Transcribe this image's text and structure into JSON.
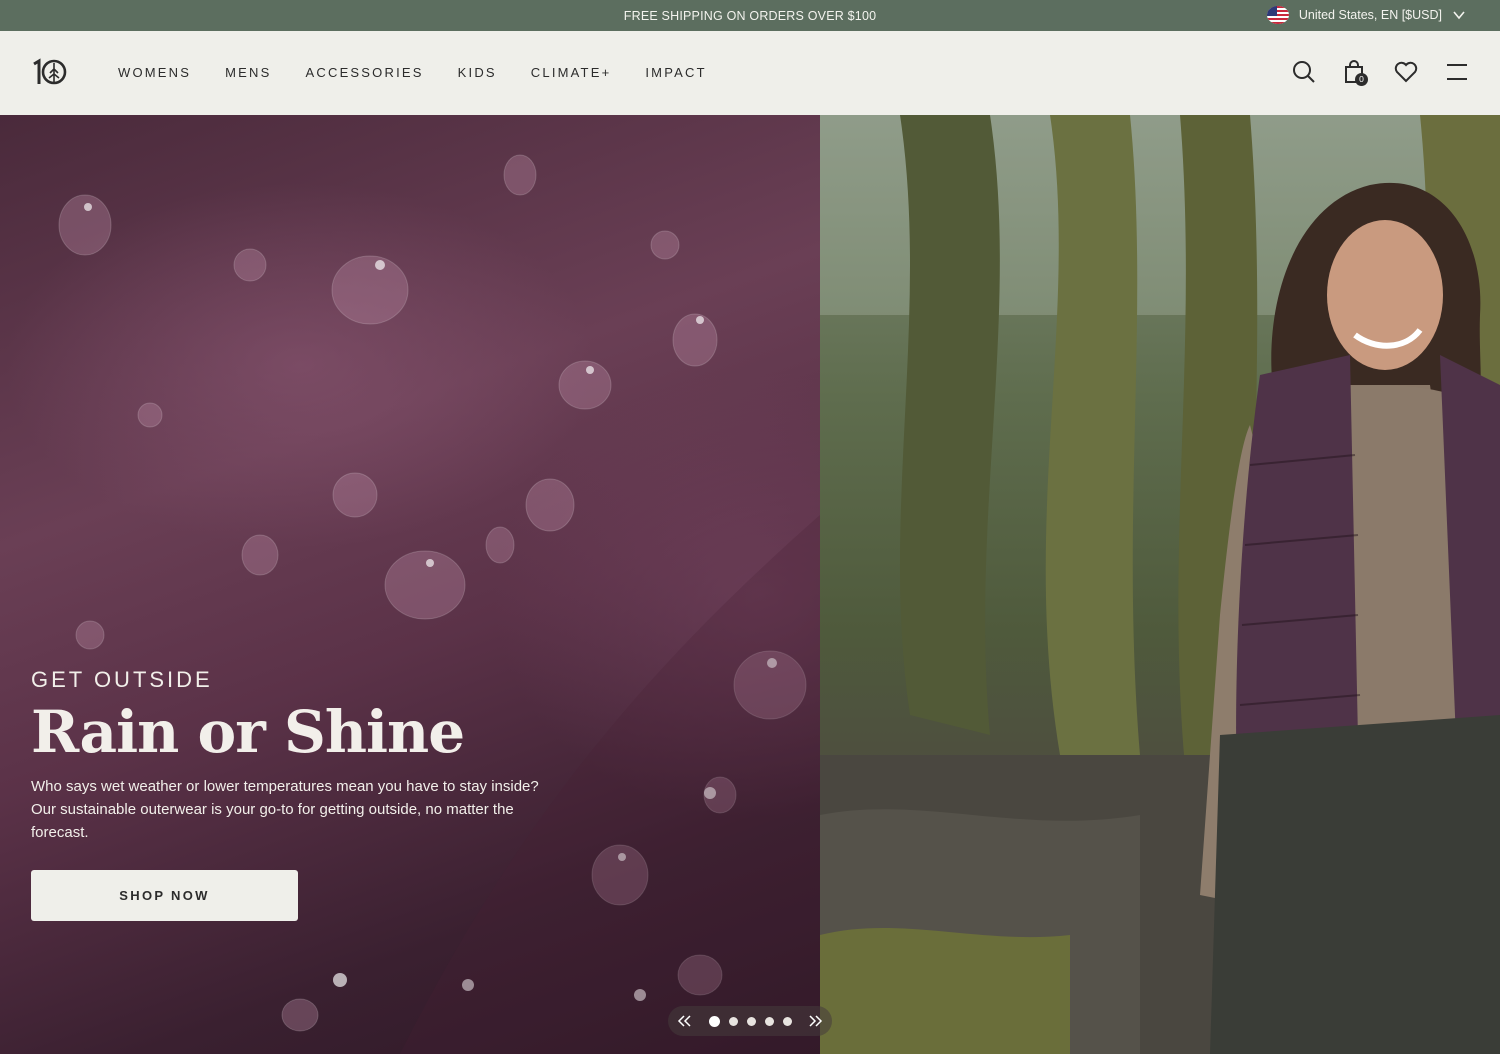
{
  "announcement": {
    "text": "FREE SHIPPING ON ORDERS OVER $100"
  },
  "locale": {
    "label": "United States, EN [$USD]",
    "flag_icon": "us-flag-icon"
  },
  "nav": {
    "logo_alt": "tentree logo",
    "items": [
      "WOMENS",
      "MENS",
      "ACCESSORIES",
      "KIDS",
      "CLIMATE+",
      "IMPACT"
    ],
    "cart_count": "0",
    "icons": [
      "search-icon",
      "bag-icon",
      "heart-icon",
      "hamburger-menu-icon"
    ]
  },
  "hero": {
    "eyebrow": "GET OUTSIDE",
    "headline": "Rain or Shine",
    "body": "Who says wet weather or lower temperatures mean you have to stay inside? Our sustainable outerwear is your go-to for getting outside, no matter the forecast.",
    "cta": "SHOP NOW",
    "slides_total": 5,
    "active_slide": 1
  },
  "colors": {
    "announcement_bg": "#5c6e5f",
    "nav_bg": "#efefea",
    "text_dark": "#2c2c2c",
    "hero_purple": "#5b3248"
  }
}
